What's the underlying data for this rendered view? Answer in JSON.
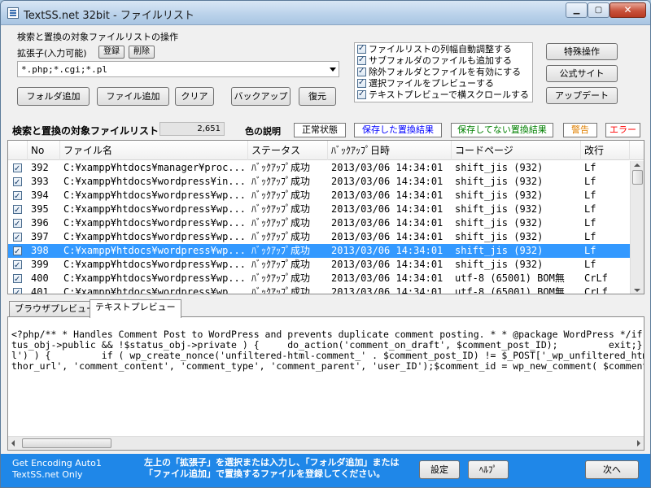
{
  "window": {
    "title": "TextSS.net 32bit - ファイルリスト",
    "controls": {
      "minimize": "▁",
      "maximize": "▢",
      "close": "✕"
    }
  },
  "ops": {
    "group_label": "検索と置換の対象ファイルリストの操作",
    "ext_label": "拡張子(入力可能)",
    "register_btn": "登録",
    "delete_btn": "削除",
    "ext_value": "*.php;*.cgi;*.pl",
    "add_folder": "フォルダ追加",
    "add_file": "ファイル追加",
    "clear": "クリア",
    "backup": "バックアップ",
    "restore": "復元"
  },
  "options": [
    {
      "label": "ファイルリストの列幅自動調整する",
      "checked": true
    },
    {
      "label": "サブフォルダのファイルも追加する",
      "checked": true
    },
    {
      "label": "除外フォルダとファイルを有効にする",
      "checked": true
    },
    {
      "label": "選択ファイルをプレビューする",
      "checked": true
    },
    {
      "label": "テキストプレビューで横スクロールする",
      "checked": true
    }
  ],
  "side_buttons": {
    "special": "特殊操作",
    "official": "公式サイト",
    "update": "アップデート"
  },
  "list": {
    "title": "検索と置換の対象ファイルリスト",
    "count": "2,651",
    "color_label": "色の説明",
    "legend": {
      "normal": "正常状態",
      "saved": "保存した置換結果",
      "unsaved": "保存してない置換結果",
      "warning": "警告",
      "error": "エラー"
    },
    "colors": {
      "saved": "#0000ff",
      "unsaved": "#008000",
      "warning": "#e08000",
      "error": "#ff0000"
    },
    "columns": [
      "No",
      "ファイル名",
      "ステータス",
      "ﾊﾞｯｸｱｯﾌﾟ日時",
      "コードページ",
      "改行"
    ],
    "rows": [
      {
        "no": "392",
        "file": "C:¥xampp¥htdocs¥manager¥proc...",
        "status": "ﾊﾞｯｸｱｯﾌﾟ成功",
        "date": "2013/03/06 14:34:01",
        "cp": "shift_jis (932)",
        "eol": "Lf",
        "checked": true,
        "selected": false
      },
      {
        "no": "393",
        "file": "C:¥xampp¥htdocs¥wordpress¥in...",
        "status": "ﾊﾞｯｸｱｯﾌﾟ成功",
        "date": "2013/03/06 14:34:01",
        "cp": "shift_jis (932)",
        "eol": "Lf",
        "checked": true,
        "selected": false
      },
      {
        "no": "394",
        "file": "C:¥xampp¥htdocs¥wordpress¥wp...",
        "status": "ﾊﾞｯｸｱｯﾌﾟ成功",
        "date": "2013/03/06 14:34:01",
        "cp": "shift_jis (932)",
        "eol": "Lf",
        "checked": true,
        "selected": false
      },
      {
        "no": "395",
        "file": "C:¥xampp¥htdocs¥wordpress¥wp...",
        "status": "ﾊﾞｯｸｱｯﾌﾟ成功",
        "date": "2013/03/06 14:34:01",
        "cp": "shift_jis (932)",
        "eol": "Lf",
        "checked": true,
        "selected": false
      },
      {
        "no": "396",
        "file": "C:¥xampp¥htdocs¥wordpress¥wp...",
        "status": "ﾊﾞｯｸｱｯﾌﾟ成功",
        "date": "2013/03/06 14:34:01",
        "cp": "shift_jis (932)",
        "eol": "Lf",
        "checked": true,
        "selected": false
      },
      {
        "no": "397",
        "file": "C:¥xampp¥htdocs¥wordpress¥wp...",
        "status": "ﾊﾞｯｸｱｯﾌﾟ成功",
        "date": "2013/03/06 14:34:01",
        "cp": "shift_jis (932)",
        "eol": "Lf",
        "checked": true,
        "selected": false
      },
      {
        "no": "398",
        "file": "C:¥xampp¥htdocs¥wordpress¥wp...",
        "status": "ﾊﾞｯｸｱｯﾌﾟ成功",
        "date": "2013/03/06 14:34:01",
        "cp": "shift_jis (932)",
        "eol": "Lf",
        "checked": true,
        "selected": true
      },
      {
        "no": "399",
        "file": "C:¥xampp¥htdocs¥wordpress¥wp...",
        "status": "ﾊﾞｯｸｱｯﾌﾟ成功",
        "date": "2013/03/06 14:34:01",
        "cp": "shift_jis (932)",
        "eol": "Lf",
        "checked": true,
        "selected": false
      },
      {
        "no": "400",
        "file": "C:¥xampp¥htdocs¥wordpress¥wp...",
        "status": "ﾊﾞｯｸｱｯﾌﾟ成功",
        "date": "2013/03/06 14:34:01",
        "cp": "utf-8 (65001) BOM無",
        "eol": "CrLf",
        "checked": true,
        "selected": false
      },
      {
        "no": "401",
        "file": "C:¥xampp¥htdocs¥wordpress¥wp...",
        "status": "ﾊﾞｯｸｱｯﾌﾟ成功",
        "date": "2013/03/06 14:34:01",
        "cp": "utf-8 (65001) BOM無",
        "eol": "CrLf",
        "checked": true,
        "selected": false
      }
    ]
  },
  "preview": {
    "tabs": [
      "ブラウザプレビュー",
      "テキストプレビュー"
    ],
    "active_tab": 1,
    "lines": [
      "<?php/** * Handles Comment Post to WordPress and prevents duplicate comment posting. * * @package WordPress */if ( 'POST' != $_SE",
      "tus_obj->public && !$status_obj->private ) {     do_action('comment_on_draft', $comment_post_ID);         exit;} elseif ( post_pas",
      "l') ) {         if ( wp_create_nonce('unfiltered-html-comment_' . $comment_post_ID) != $_POST['_wp_unfiltered_html_comment'] ) {",
      "thor_url', 'comment_content', 'comment_type', 'comment_parent', 'user_ID');$comment_id = wp_new_comment( $commentdata );$comment ="
    ]
  },
  "status": {
    "left_line1": "Get Encoding Auto1",
    "left_line2": "TextSS.net Only",
    "msg_line1": "左上の「拡張子」を選択または入力し、「フォルダ追加」または",
    "msg_line2": "「ファイル追加」で置換するファイルを登録してください。",
    "settings": "設定",
    "help": "ﾍﾙﾌﾟ",
    "next": "次へ"
  }
}
